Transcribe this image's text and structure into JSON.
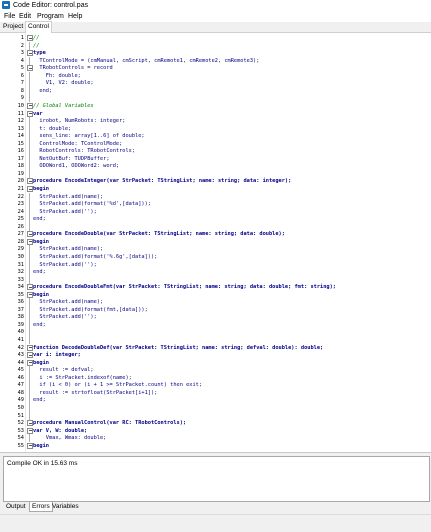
{
  "window": {
    "title": "Code Editor: control.pas",
    "icon": "app-icon"
  },
  "menu": {
    "items": [
      "File",
      "Edit",
      "Program",
      "Help"
    ]
  },
  "tabs": {
    "items": [
      "Project",
      "Control"
    ],
    "active": 1
  },
  "editor": {
    "lines": [
      {
        "n": "1",
        "text": "//",
        "fold": true
      },
      {
        "n": "2",
        "text": "//",
        "fold": false
      },
      {
        "n": "3",
        "text": "type",
        "fold": true
      },
      {
        "n": "4",
        "text": "  TControlMode = (cmManual, cmScript, cmRemote1, cmRemote2, cmRemote3);",
        "fold": false
      },
      {
        "n": "5",
        "text": "  TRobotControls = record",
        "fold": true
      },
      {
        "n": "6",
        "text": "    Fh: double;",
        "fold": false
      },
      {
        "n": "7",
        "text": "    V1, V2: double;",
        "fold": false
      },
      {
        "n": "8",
        "text": "  end;",
        "fold": false
      },
      {
        "n": "9",
        "text": "",
        "fold": false
      },
      {
        "n": "10",
        "text": "// Global Variables",
        "fold": true
      },
      {
        "n": "11",
        "text": "var",
        "fold": true
      },
      {
        "n": "12",
        "text": "  irobot, NumRobots: integer;",
        "fold": false
      },
      {
        "n": "13",
        "text": "  t: double;",
        "fold": false
      },
      {
        "n": "14",
        "text": "  sens_line: array[1..6] of double;",
        "fold": false
      },
      {
        "n": "15",
        "text": "  ControlMode: TControlMode;",
        "fold": false
      },
      {
        "n": "16",
        "text": "  RobotControls: TRobotControls;",
        "fold": false
      },
      {
        "n": "17",
        "text": "  NetOutBuf: TUDPBuffer;",
        "fold": false
      },
      {
        "n": "18",
        "text": "  ODOWord1, ODOWord2: word;",
        "fold": false
      },
      {
        "n": "19",
        "text": "",
        "fold": false
      },
      {
        "n": "20",
        "text": "procedure EncodeInteger(var StrPacket: TStringList; name: string; data: integer);",
        "fold": true
      },
      {
        "n": "21",
        "text": "begin",
        "fold": true
      },
      {
        "n": "22",
        "text": "  StrPacket.add(name);",
        "fold": false
      },
      {
        "n": "23",
        "text": "  StrPacket.add(format('%d',[data]));",
        "fold": false
      },
      {
        "n": "24",
        "text": "  StrPacket.add('');",
        "fold": false
      },
      {
        "n": "25",
        "text": "end;",
        "fold": false
      },
      {
        "n": "26",
        "text": "",
        "fold": false
      },
      {
        "n": "27",
        "text": "procedure EncodeDouble(var StrPacket: TStringList; name: string; data: double);",
        "fold": true
      },
      {
        "n": "28",
        "text": "begin",
        "fold": true
      },
      {
        "n": "29",
        "text": "  StrPacket.add(name);",
        "fold": false
      },
      {
        "n": "30",
        "text": "  StrPacket.add(format('%.6g',[data]));",
        "fold": false
      },
      {
        "n": "31",
        "text": "  StrPacket.add('');",
        "fold": false
      },
      {
        "n": "32",
        "text": "end;",
        "fold": false
      },
      {
        "n": "33",
        "text": "",
        "fold": false
      },
      {
        "n": "34",
        "text": "procedure EncodeDoubleFmt(var StrPacket: TStringList; name: string; data: double; fmt: string);",
        "fold": true
      },
      {
        "n": "35",
        "text": "begin",
        "fold": true
      },
      {
        "n": "36",
        "text": "  StrPacket.add(name);",
        "fold": false
      },
      {
        "n": "37",
        "text": "  StrPacket.add(format(fmt,[data]));",
        "fold": false
      },
      {
        "n": "38",
        "text": "  StrPacket.add('');",
        "fold": false
      },
      {
        "n": "39",
        "text": "end;",
        "fold": false
      },
      {
        "n": "40",
        "text": "",
        "fold": false
      },
      {
        "n": "41",
        "text": "",
        "fold": false
      },
      {
        "n": "42",
        "text": "function DecodeDoubleDef(var StrPacket: TStringList; name: string; defval: double): double;",
        "fold": true
      },
      {
        "n": "43",
        "text": "var i: integer;",
        "fold": true
      },
      {
        "n": "44",
        "text": "begin",
        "fold": true
      },
      {
        "n": "45",
        "text": "  result := defval;",
        "fold": false
      },
      {
        "n": "46",
        "text": "  i := StrPacket.indexof(name);",
        "fold": false
      },
      {
        "n": "47",
        "text": "  if (i < 0) or (i + 1 >= StrPacket.count) then exit;",
        "fold": false
      },
      {
        "n": "48",
        "text": "  result := strtofloat(StrPacket[i+1]);",
        "fold": false
      },
      {
        "n": "49",
        "text": "end;",
        "fold": false
      },
      {
        "n": "50",
        "text": "",
        "fold": false
      },
      {
        "n": "51",
        "text": "",
        "fold": false
      },
      {
        "n": "52",
        "text": "procedure ManualControl(var RC: TRobotControls);",
        "fold": true
      },
      {
        "n": "53",
        "text": "var V, W: double;",
        "fold": true
      },
      {
        "n": "54",
        "text": "    Vmax, Wmax: double;",
        "fold": false
      },
      {
        "n": "55",
        "text": "begin",
        "fold": true
      }
    ]
  },
  "messages": {
    "text": "Compile OK in 15.63 ms"
  },
  "bottom_tabs": {
    "items": [
      "Output",
      "Errors",
      "Variables"
    ],
    "active": 1
  }
}
